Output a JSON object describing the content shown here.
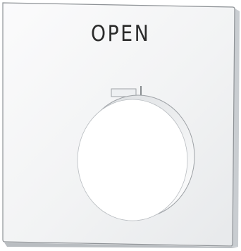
{
  "legend_plate": {
    "label": "OPEN",
    "plate_color": "#f4f5f6",
    "edge_color": "#8e9296",
    "text_color": "#2a2a2a"
  }
}
